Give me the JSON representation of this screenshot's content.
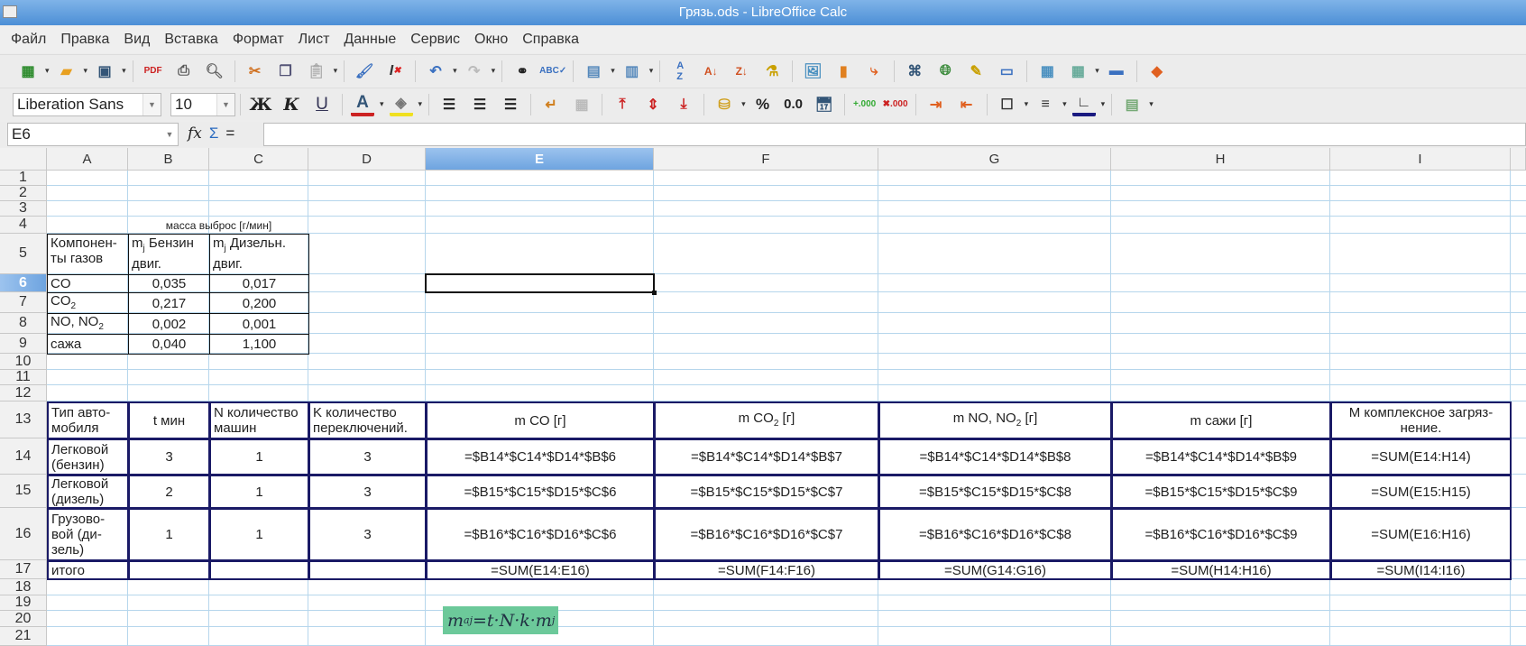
{
  "window": {
    "title": "Грязь.ods - LibreOffice Calc"
  },
  "menu": [
    "Файл",
    "Правка",
    "Вид",
    "Вставка",
    "Формат",
    "Лист",
    "Данные",
    "Сервис",
    "Окно",
    "Справка"
  ],
  "format_bar": {
    "font_name": "Liberation Sans",
    "font_size": "10",
    "bold": "Ж",
    "italic": "К",
    "underline": "U",
    "percent": "%",
    "number": "0.0"
  },
  "formula_bar": {
    "name_box": "E6",
    "content": ""
  },
  "columns": [
    "A",
    "B",
    "C",
    "D",
    "E",
    "F",
    "G",
    "H",
    "I"
  ],
  "selected_cell": "E6",
  "rows": [
    "1",
    "2",
    "3",
    "4",
    "5",
    "6",
    "7",
    "8",
    "9",
    "10",
    "11",
    "12",
    "13",
    "14",
    "15",
    "16",
    "17",
    "18",
    "19",
    "20",
    "21"
  ],
  "cells": [
    {
      "ref": "B4",
      "text": "масса выброс [г/мин]"
    },
    {
      "ref": "A5",
      "text": "Компонен-\nты газов"
    },
    {
      "ref": "B5",
      "text": "m",
      "sub": "j",
      "after": " Бензин\nдвиг."
    },
    {
      "ref": "C5",
      "text": "m",
      "sub": "j",
      "after": " Дизельн.\nдвиг."
    },
    {
      "ref": "A6",
      "text": "CO"
    },
    {
      "ref": "B6",
      "text": "0,035"
    },
    {
      "ref": "C6",
      "text": "0,017"
    },
    {
      "ref": "A7",
      "text": "CO",
      "sub": "2"
    },
    {
      "ref": "B7",
      "text": "0,217"
    },
    {
      "ref": "C7",
      "text": "0,200"
    },
    {
      "ref": "A8",
      "text": "NO, NO",
      "sub": "2"
    },
    {
      "ref": "B8",
      "text": "0,002"
    },
    {
      "ref": "C8",
      "text": "0,001"
    },
    {
      "ref": "A9",
      "text": "сажа"
    },
    {
      "ref": "B9",
      "text": "0,040"
    },
    {
      "ref": "C9",
      "text": "1,100"
    },
    {
      "ref": "A13",
      "text": "Тип авто-\nмобиля"
    },
    {
      "ref": "B13",
      "text": "t мин"
    },
    {
      "ref": "C13",
      "text": "N количество\nмашин"
    },
    {
      "ref": "D13",
      "text": "K количество\nпереключений."
    },
    {
      "ref": "E13",
      "text": "m CO [г]"
    },
    {
      "ref": "F13",
      "text": "m CO",
      "sub": "2",
      "after": " [г]"
    },
    {
      "ref": "G13",
      "text": "m NO, NO",
      "sub": "2",
      "after": " [г]"
    },
    {
      "ref": "H13",
      "text": "m сажи [г]"
    },
    {
      "ref": "I13",
      "text": "M комплексное загряз-\nнение."
    },
    {
      "ref": "A14",
      "text": "Легковой\n(бензин)"
    },
    {
      "ref": "B14",
      "text": "3"
    },
    {
      "ref": "C14",
      "text": "1"
    },
    {
      "ref": "D14",
      "text": "3"
    },
    {
      "ref": "E14",
      "text": "=$B14*$C14*$D14*$B$6"
    },
    {
      "ref": "F14",
      "text": "=$B14*$C14*$D14*$B$7"
    },
    {
      "ref": "G14",
      "text": "=$B14*$C14*$D14*$B$8"
    },
    {
      "ref": "H14",
      "text": "=$B14*$C14*$D14*$B$9"
    },
    {
      "ref": "I14",
      "text": "=SUM(E14:H14)"
    },
    {
      "ref": "A15",
      "text": "Легковой\n(дизель)"
    },
    {
      "ref": "B15",
      "text": "2"
    },
    {
      "ref": "C15",
      "text": "1"
    },
    {
      "ref": "D15",
      "text": "3"
    },
    {
      "ref": "E15",
      "text": "=$B15*$C15*$D15*$C$6"
    },
    {
      "ref": "F15",
      "text": "=$B15*$C15*$D15*$C$7"
    },
    {
      "ref": "G15",
      "text": "=$B15*$C15*$D15*$C$8"
    },
    {
      "ref": "H15",
      "text": "=$B15*$C15*$D15*$C$9"
    },
    {
      "ref": "I15",
      "text": "=SUM(E15:H15)"
    },
    {
      "ref": "A16",
      "text": "Грузово-\nвой (ди-\nзель)"
    },
    {
      "ref": "B16",
      "text": "1"
    },
    {
      "ref": "C16",
      "text": "1"
    },
    {
      "ref": "D16",
      "text": "3"
    },
    {
      "ref": "E16",
      "text": "=$B16*$C16*$D16*$C$6"
    },
    {
      "ref": "F16",
      "text": "=$B16*$C16*$D16*$C$7"
    },
    {
      "ref": "G16",
      "text": "=$B16*$C16*$D16*$C$8"
    },
    {
      "ref": "H16",
      "text": "=$B16*$C16*$D16*$C$9"
    },
    {
      "ref": "I16",
      "text": "=SUM(E16:H16)"
    },
    {
      "ref": "A17",
      "text": "итого"
    },
    {
      "ref": "B17",
      "text": ""
    },
    {
      "ref": "C17",
      "text": ""
    },
    {
      "ref": "D17",
      "text": ""
    },
    {
      "ref": "E17",
      "text": "=SUM(E14:E16)"
    },
    {
      "ref": "F17",
      "text": "=SUM(F14:F16)"
    },
    {
      "ref": "G17",
      "text": "=SUM(G14:G16)"
    },
    {
      "ref": "H17",
      "text": "=SUM(H14:H16)"
    },
    {
      "ref": "I17",
      "text": "=SUM(I14:I16)"
    }
  ],
  "formula_object": {
    "lhs": "m",
    "lhs_sub": "aj",
    "rhs": "=t·N·k·m",
    "rhs_sub": "j"
  },
  "colors": {
    "table_border": "#1a1a66",
    "formula_bg": "#6cc99a",
    "selection": "#6ea4e0"
  }
}
